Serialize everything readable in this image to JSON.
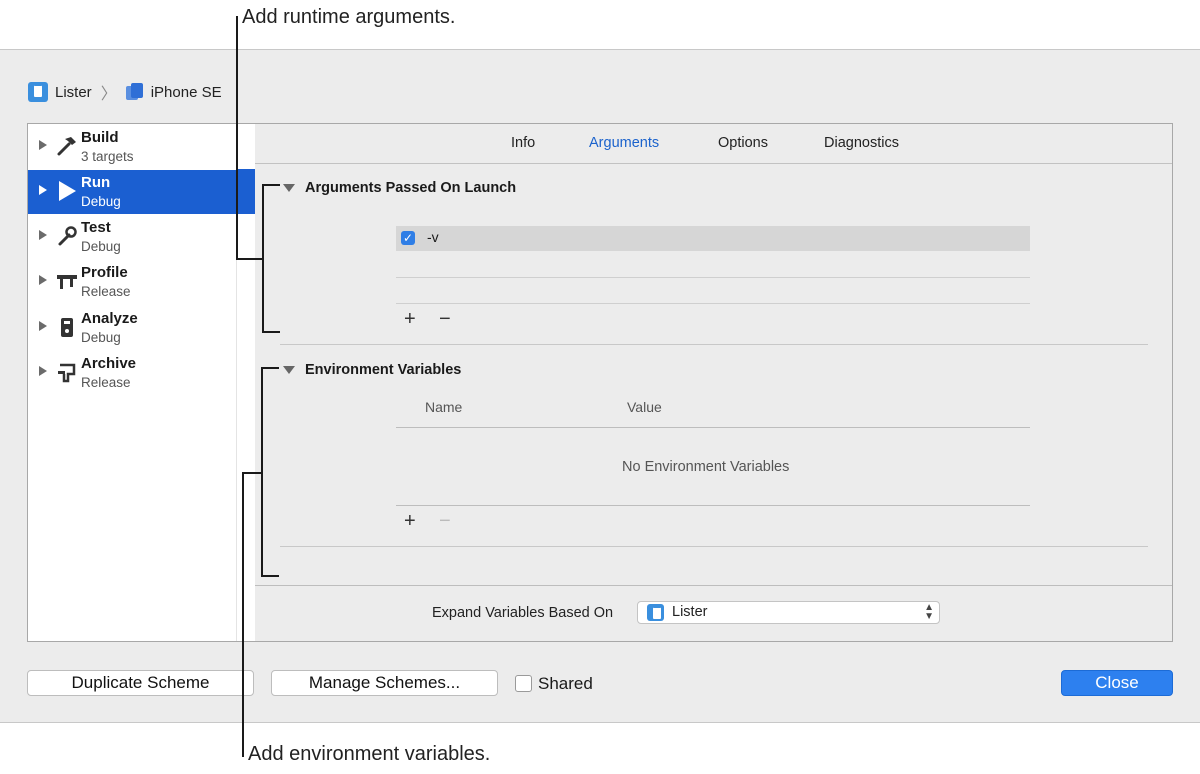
{
  "callouts": {
    "top": "Add runtime arguments.",
    "bottom": "Add environment variables."
  },
  "breadcrumb": {
    "project": "Lister",
    "device": "iPhone SE"
  },
  "sidebar": {
    "items": [
      {
        "title": "Build",
        "subtitle": "3 targets",
        "icon": "hammer-icon",
        "selected": false
      },
      {
        "title": "Run",
        "subtitle": "Debug",
        "icon": "play-icon",
        "selected": true
      },
      {
        "title": "Test",
        "subtitle": "Debug",
        "icon": "wrench-icon",
        "selected": false
      },
      {
        "title": "Profile",
        "subtitle": "Release",
        "icon": "caliper-icon",
        "selected": false
      },
      {
        "title": "Analyze",
        "subtitle": "Debug",
        "icon": "analyze-icon",
        "selected": false
      },
      {
        "title": "Archive",
        "subtitle": "Release",
        "icon": "archive-icon",
        "selected": false
      }
    ]
  },
  "tabs": [
    {
      "label": "Info",
      "active": false
    },
    {
      "label": "Arguments",
      "active": true
    },
    {
      "label": "Options",
      "active": false
    },
    {
      "label": "Diagnostics",
      "active": false
    }
  ],
  "arguments": {
    "heading": "Arguments Passed On Launch",
    "rows": [
      {
        "checked": true,
        "value": "-v"
      }
    ]
  },
  "environment": {
    "heading": "Environment Variables",
    "col_name": "Name",
    "col_value": "Value",
    "empty_text": "No Environment Variables"
  },
  "controls": {
    "plus": "+",
    "minus": "−"
  },
  "expand": {
    "label": "Expand Variables Based On",
    "selected": "Lister"
  },
  "footer": {
    "duplicate": "Duplicate Scheme",
    "manage": "Manage Schemes...",
    "shared": "Shared",
    "close": "Close"
  },
  "colors": {
    "selection": "#1b5fd1",
    "active_tab": "#1c63cc",
    "primary_button": "#2d80ef"
  }
}
